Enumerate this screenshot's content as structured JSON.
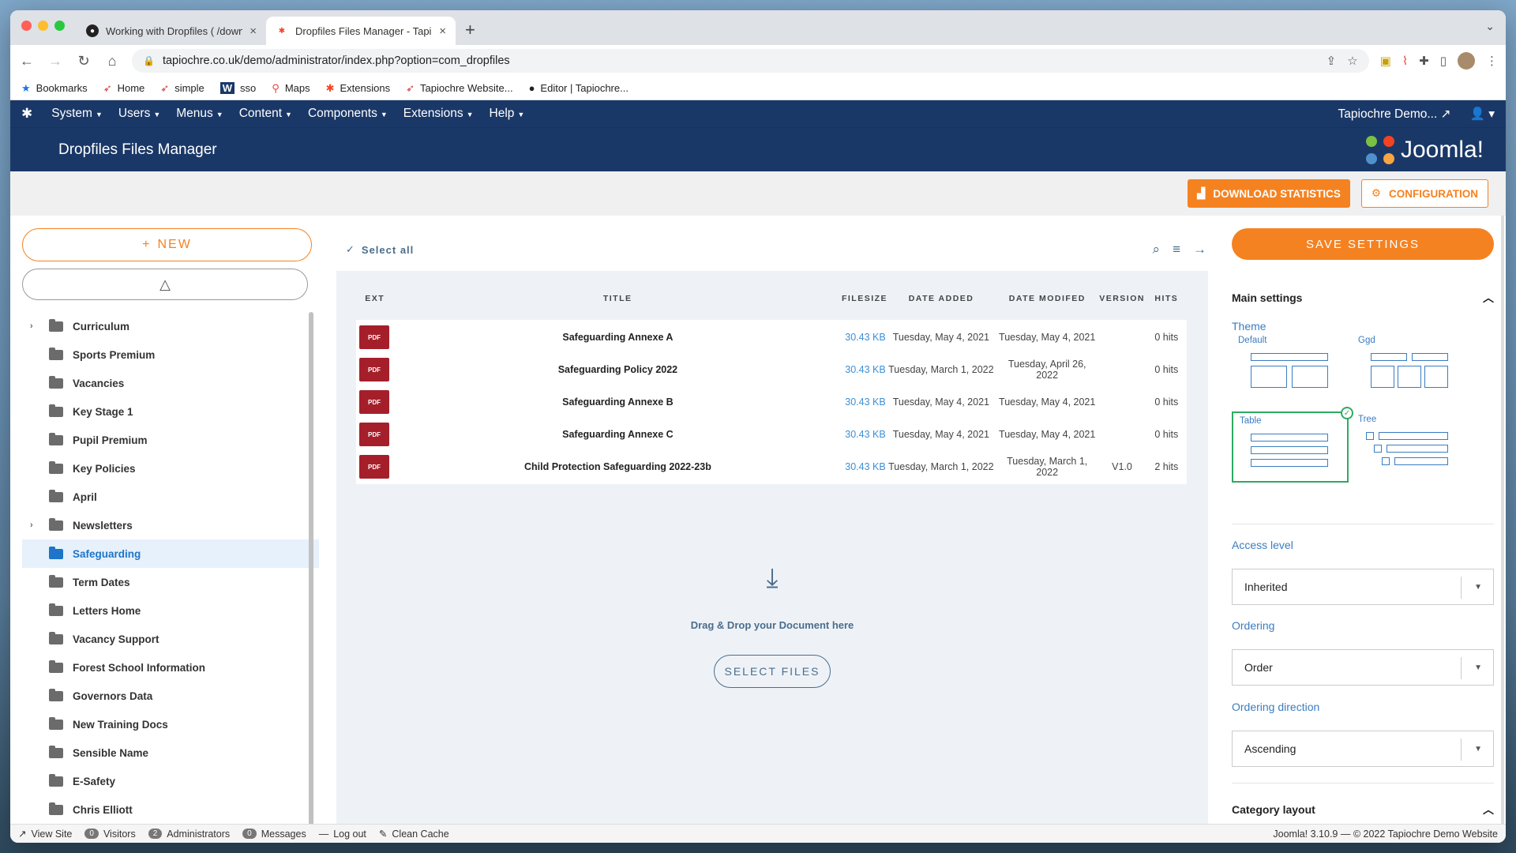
{
  "browser": {
    "tabs": [
      {
        "title": "Working with Dropfiles ( /down",
        "active": false
      },
      {
        "title": "Dropfiles Files Manager - Tapio",
        "active": true
      }
    ],
    "url": "tapiochre.co.uk/demo/administrator/index.php?option=com_dropfiles",
    "bookmarks": [
      "Bookmarks",
      "Home",
      "simple",
      "sso",
      "Maps",
      "Extensions",
      "Tapiochre Website...",
      "Editor | Tapiochre..."
    ]
  },
  "joomla": {
    "menu": [
      "System",
      "Users",
      "Menus",
      "Content",
      "Components",
      "Extensions",
      "Help"
    ],
    "site_name": "Tapiochre Demo...",
    "page_title": "Dropfiles Files Manager",
    "brand": "Joomla!"
  },
  "actions": {
    "download_stats": "DOWNLOAD STATISTICS",
    "configuration": "CONFIGURATION"
  },
  "left": {
    "new_label": "NEW",
    "categories": [
      {
        "name": "Curriculum",
        "expandable": true,
        "active": false
      },
      {
        "name": "Sports Premium",
        "expandable": false,
        "active": false
      },
      {
        "name": "Vacancies",
        "expandable": false,
        "active": false
      },
      {
        "name": "Key Stage 1",
        "expandable": false,
        "active": false
      },
      {
        "name": "Pupil Premium",
        "expandable": false,
        "active": false
      },
      {
        "name": "Key Policies",
        "expandable": false,
        "active": false
      },
      {
        "name": "April",
        "expandable": false,
        "active": false
      },
      {
        "name": "Newsletters",
        "expandable": true,
        "active": false
      },
      {
        "name": "Safeguarding",
        "expandable": false,
        "active": true
      },
      {
        "name": "Term Dates",
        "expandable": false,
        "active": false
      },
      {
        "name": "Letters Home",
        "expandable": false,
        "active": false
      },
      {
        "name": "Vacancy Support",
        "expandable": false,
        "active": false
      },
      {
        "name": "Forest School Information",
        "expandable": false,
        "active": false
      },
      {
        "name": "Governors Data",
        "expandable": false,
        "active": false
      },
      {
        "name": "New Training Docs",
        "expandable": false,
        "active": false
      },
      {
        "name": "Sensible Name",
        "expandable": false,
        "active": false
      },
      {
        "name": "E-Safety",
        "expandable": false,
        "active": false
      },
      {
        "name": "Chris Elliott",
        "expandable": false,
        "active": false
      }
    ]
  },
  "files": {
    "select_all": "Select all",
    "columns": {
      "ext": "EXT",
      "title": "TITLE",
      "filesize": "FILESIZE",
      "added": "DATE ADDED",
      "modified": "DATE MODIFED",
      "version": "VERSION",
      "hits": "HITS"
    },
    "rows": [
      {
        "ext": "PDF",
        "title": "Safeguarding Annexe A",
        "size": "30.43 KB",
        "added": "Tuesday, May 4, 2021",
        "modified": "Tuesday, May 4, 2021",
        "version": "",
        "hits": "0 hits"
      },
      {
        "ext": "PDF",
        "title": "Safeguarding Policy 2022",
        "size": "30.43 KB",
        "added": "Tuesday, March 1, 2022",
        "modified": "Tuesday, April 26, 2022",
        "version": "",
        "hits": "0 hits"
      },
      {
        "ext": "PDF",
        "title": "Safeguarding Annexe B",
        "size": "30.43 KB",
        "added": "Tuesday, May 4, 2021",
        "modified": "Tuesday, May 4, 2021",
        "version": "",
        "hits": "0 hits"
      },
      {
        "ext": "PDF",
        "title": "Safeguarding Annexe C",
        "size": "30.43 KB",
        "added": "Tuesday, May 4, 2021",
        "modified": "Tuesday, May 4, 2021",
        "version": "",
        "hits": "0 hits"
      },
      {
        "ext": "PDF",
        "title": "Child Protection Safeguarding 2022-23b",
        "size": "30.43 KB",
        "added": "Tuesday, March 1, 2022",
        "modified": "Tuesday, March 1, 2022",
        "version": "V1.0",
        "hits": "2 hits"
      }
    ],
    "drop_text": "Drag & Drop your Document here",
    "select_files": "SELECT FILES"
  },
  "settings": {
    "save": "SAVE SETTINGS",
    "main_settings": "Main settings",
    "theme_label": "Theme",
    "themes": [
      "Default",
      "Ggd",
      "Table",
      "Tree"
    ],
    "selected_theme": "Table",
    "access_label": "Access level",
    "access_value": "Inherited",
    "ordering_label": "Ordering",
    "ordering_value": "Order",
    "direction_label": "Ordering direction",
    "direction_value": "Ascending",
    "category_layout": "Category layout"
  },
  "status": {
    "view_site": "View Site",
    "visitors_count": "0",
    "visitors": "Visitors",
    "admins_count": "2",
    "admins": "Administrators",
    "messages_count": "0",
    "messages": "Messages",
    "logout": "Log out",
    "clean_cache": "Clean Cache",
    "version": "Joomla! 3.10.9 — © 2022 Tapiochre Demo Website"
  },
  "colors": {
    "accent": "#f58220",
    "navy": "#1a3867",
    "link": "#3b8fd6",
    "active_folder": "#1d74c9"
  }
}
